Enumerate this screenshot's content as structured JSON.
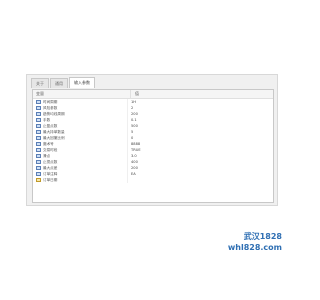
{
  "tabs": [
    {
      "label": "关于",
      "active": false
    },
    {
      "label": "通用",
      "active": false
    },
    {
      "label": "输入参数",
      "active": true
    }
  ],
  "header": {
    "variable": "变量",
    "value": "值"
  },
  "params": [
    {
      "name": "时间周期",
      "value": "1H",
      "icon": "table-icon"
    },
    {
      "name": "风险参数",
      "value": "2",
      "icon": "table-icon"
    },
    {
      "name": "趋势均线周期",
      "value": "200",
      "icon": "table-icon"
    },
    {
      "name": "手数",
      "value": "0.1",
      "icon": "table-icon"
    },
    {
      "name": "止盈点数",
      "value": "500",
      "icon": "table-icon"
    },
    {
      "name": "最大持单数量",
      "value": "5",
      "icon": "table-icon"
    },
    {
      "name": "最大回撤比例",
      "value": "0",
      "icon": "table-icon"
    },
    {
      "name": "魔术号",
      "value": "8888",
      "icon": "table-icon"
    },
    {
      "name": "交易时段",
      "value": "TRUE",
      "icon": "table-icon"
    },
    {
      "name": "滑点",
      "value": "3.0",
      "icon": "table-icon"
    },
    {
      "name": "止损点数",
      "value": "400",
      "icon": "table-icon"
    },
    {
      "name": "最大点差",
      "value": "200",
      "icon": "table-icon"
    },
    {
      "name": "订单注释",
      "value": "EA",
      "icon": "table-icon"
    },
    {
      "name": "订单日期",
      "value": "",
      "icon": "warning-icon"
    }
  ],
  "watermark": {
    "line1": "武汉1828",
    "line2": "whl828.com"
  }
}
